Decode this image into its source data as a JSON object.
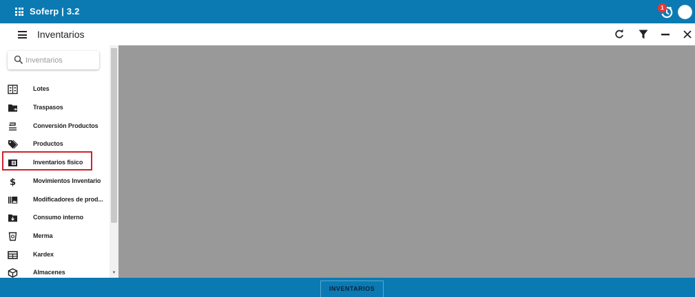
{
  "app": {
    "title": "Soferp | 3.2",
    "notification_count": "1"
  },
  "header": {
    "title": "Inventarios",
    "buttons": [
      "refresh-icon",
      "filter-icon",
      "minimize-icon",
      "close-icon"
    ]
  },
  "sidebar": {
    "search_placeholder": "Inventarios",
    "items": [
      {
        "label": "Lotes",
        "icon": "lots-icon"
      },
      {
        "label": "Traspasos",
        "icon": "transfer-folder-icon"
      },
      {
        "label": "Conversión Productos",
        "icon": "conversion-icon"
      },
      {
        "label": "Productos",
        "icon": "tags-icon"
      },
      {
        "label": "Inventarios fisico",
        "icon": "physical-inventory-icon"
      },
      {
        "label": "Movimientos Inventario",
        "icon": "dollar-icon"
      },
      {
        "label": "Modificadores de prod...",
        "icon": "modifiers-icon"
      },
      {
        "label": "Consumo interno",
        "icon": "folder-download-icon"
      },
      {
        "label": "Merma",
        "icon": "waste-bin-icon"
      },
      {
        "label": "Kardex",
        "icon": "table-icon"
      },
      {
        "label": "Almacenes",
        "icon": "box-icon"
      }
    ],
    "highlighted_item": "Inventarios fisico"
  },
  "footer": {
    "tab_label": "INVENTARIOS"
  },
  "colors": {
    "primary": "#0b7ab3",
    "content_bg": "#999999",
    "highlight_border": "#d0202a",
    "badge": "#e53935"
  }
}
